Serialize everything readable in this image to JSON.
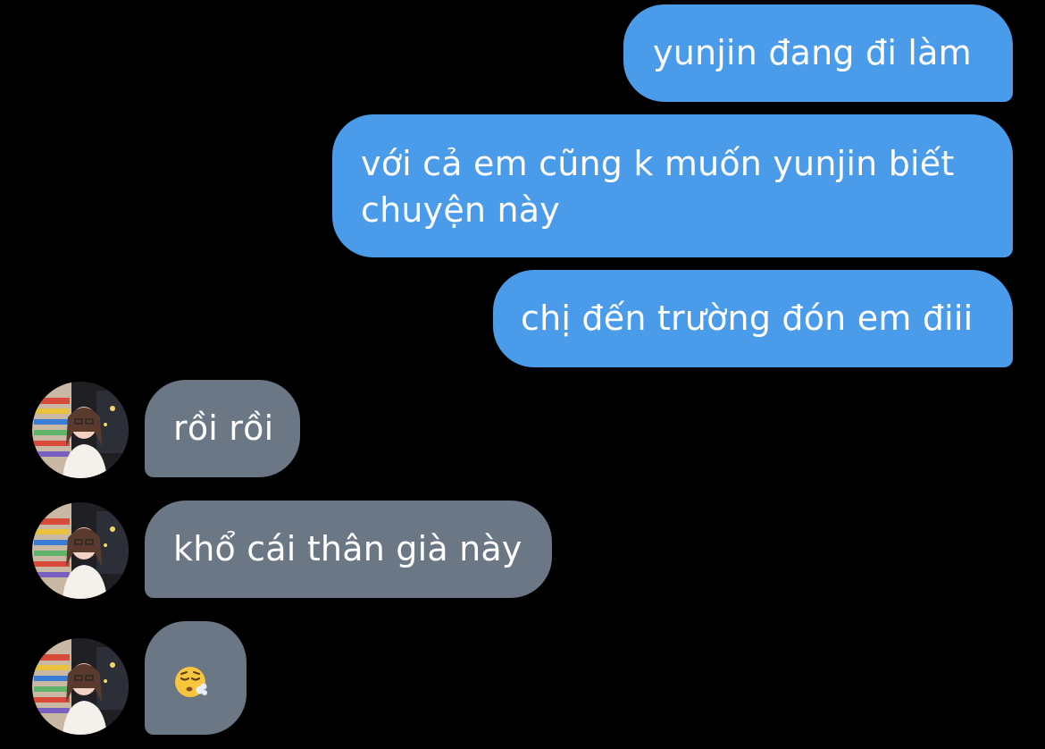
{
  "messages": [
    {
      "from": "me",
      "text": "yunjin đang đi làm"
    },
    {
      "from": "me",
      "text": "với cả em cũng k muốn yunjin biết chuyện này"
    },
    {
      "from": "me",
      "text": "chị đến trường đón em điii"
    },
    {
      "from": "them",
      "text": "rồi rồi"
    },
    {
      "from": "them",
      "text": "khổ cái thân già này"
    },
    {
      "from": "them",
      "emoji": "sighing-face-emoji"
    }
  ],
  "colors": {
    "background": "#000000",
    "sent_bubble": "#4a9bea",
    "received_bubble": "#6c7785",
    "text": "#ffffff"
  }
}
